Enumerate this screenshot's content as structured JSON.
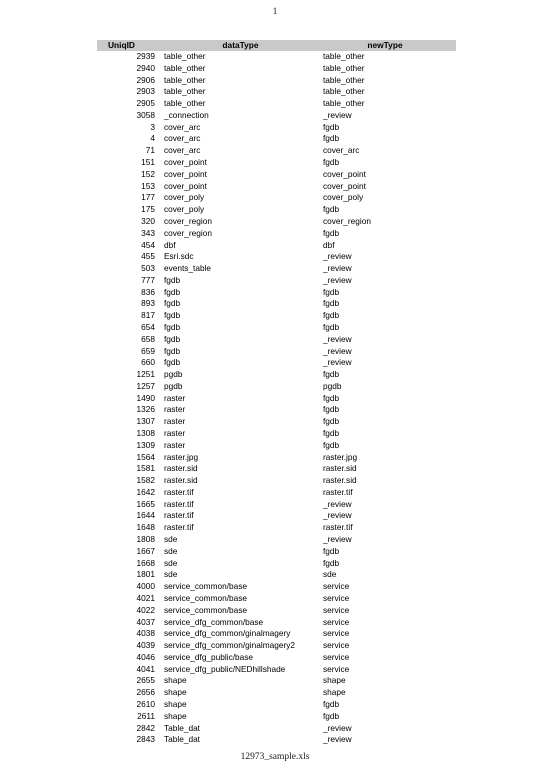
{
  "document": {
    "page_number": "1",
    "filename": "12973_sample.xls"
  },
  "table": {
    "columns": [
      {
        "key": "uniqid",
        "label": "UniqID"
      },
      {
        "key": "datatype",
        "label": "dataType"
      },
      {
        "key": "newtype",
        "label": "newType"
      }
    ],
    "header_background": "#c9c9c9",
    "rows": [
      {
        "uniqid": "2939",
        "datatype": "table_other",
        "newtype": "table_other"
      },
      {
        "uniqid": "2940",
        "datatype": "table_other",
        "newtype": "table_other"
      },
      {
        "uniqid": "2906",
        "datatype": "table_other",
        "newtype": "table_other"
      },
      {
        "uniqid": "2903",
        "datatype": "table_other",
        "newtype": "table_other"
      },
      {
        "uniqid": "2905",
        "datatype": "table_other",
        "newtype": "table_other"
      },
      {
        "uniqid": "3058",
        "datatype": "_connection",
        "newtype": "_review"
      },
      {
        "uniqid": "3",
        "datatype": "cover_arc",
        "newtype": "fgdb"
      },
      {
        "uniqid": "4",
        "datatype": "cover_arc",
        "newtype": "fgdb"
      },
      {
        "uniqid": "71",
        "datatype": "cover_arc",
        "newtype": "cover_arc"
      },
      {
        "uniqid": "151",
        "datatype": "cover_point",
        "newtype": "fgdb"
      },
      {
        "uniqid": "152",
        "datatype": "cover_point",
        "newtype": "cover_point"
      },
      {
        "uniqid": "153",
        "datatype": "cover_point",
        "newtype": "cover_point"
      },
      {
        "uniqid": "177",
        "datatype": "cover_poly",
        "newtype": "cover_poly"
      },
      {
        "uniqid": "175",
        "datatype": "cover_poly",
        "newtype": "fgdb"
      },
      {
        "uniqid": "320",
        "datatype": "cover_region",
        "newtype": "cover_region"
      },
      {
        "uniqid": "343",
        "datatype": "cover_region",
        "newtype": "fgdb"
      },
      {
        "uniqid": "454",
        "datatype": "dbf",
        "newtype": "dbf"
      },
      {
        "uniqid": "455",
        "datatype": "Esri.sdc",
        "newtype": "_review"
      },
      {
        "uniqid": "503",
        "datatype": "events_table",
        "newtype": "_review"
      },
      {
        "uniqid": "777",
        "datatype": "fgdb",
        "newtype": "_review"
      },
      {
        "uniqid": "836",
        "datatype": "fgdb",
        "newtype": "fgdb"
      },
      {
        "uniqid": "893",
        "datatype": "fgdb",
        "newtype": "fgdb"
      },
      {
        "uniqid": "817",
        "datatype": "fgdb",
        "newtype": "fgdb"
      },
      {
        "uniqid": "654",
        "datatype": "fgdb",
        "newtype": "fgdb"
      },
      {
        "uniqid": "658",
        "datatype": "fgdb",
        "newtype": "_review"
      },
      {
        "uniqid": "659",
        "datatype": "fgdb",
        "newtype": "_review"
      },
      {
        "uniqid": "660",
        "datatype": "fgdb",
        "newtype": "_review"
      },
      {
        "uniqid": "1251",
        "datatype": "pgdb",
        "newtype": "fgdb"
      },
      {
        "uniqid": "1257",
        "datatype": "pgdb",
        "newtype": "pgdb"
      },
      {
        "uniqid": "1490",
        "datatype": "raster",
        "newtype": "fgdb"
      },
      {
        "uniqid": "1326",
        "datatype": "raster",
        "newtype": "fgdb"
      },
      {
        "uniqid": "1307",
        "datatype": "raster",
        "newtype": "fgdb"
      },
      {
        "uniqid": "1308",
        "datatype": "raster",
        "newtype": "fgdb"
      },
      {
        "uniqid": "1309",
        "datatype": "raster",
        "newtype": "fgdb"
      },
      {
        "uniqid": "1564",
        "datatype": "raster.jpg",
        "newtype": "raster.jpg"
      },
      {
        "uniqid": "1581",
        "datatype": "raster.sid",
        "newtype": "raster.sid"
      },
      {
        "uniqid": "1582",
        "datatype": "raster.sid",
        "newtype": "raster.sid"
      },
      {
        "uniqid": "1642",
        "datatype": "raster.tif",
        "newtype": "raster.tif"
      },
      {
        "uniqid": "1665",
        "datatype": "raster.tif",
        "newtype": "_review"
      },
      {
        "uniqid": "1644",
        "datatype": "raster.tif",
        "newtype": "_review"
      },
      {
        "uniqid": "1648",
        "datatype": "raster.tif",
        "newtype": "raster.tif"
      },
      {
        "uniqid": "1808",
        "datatype": "sde",
        "newtype": "_review"
      },
      {
        "uniqid": "1667",
        "datatype": "sde",
        "newtype": "fgdb"
      },
      {
        "uniqid": "1668",
        "datatype": "sde",
        "newtype": "fgdb"
      },
      {
        "uniqid": "1801",
        "datatype": "sde",
        "newtype": "sde"
      },
      {
        "uniqid": "4000",
        "datatype": "service_common/base",
        "newtype": "service"
      },
      {
        "uniqid": "4021",
        "datatype": "service_common/base",
        "newtype": "service"
      },
      {
        "uniqid": "4022",
        "datatype": "service_common/base",
        "newtype": "service"
      },
      {
        "uniqid": "4037",
        "datatype": "service_dfg_common/base",
        "newtype": "service"
      },
      {
        "uniqid": "4038",
        "datatype": "service_dfg_common/ginalmagery",
        "newtype": "service"
      },
      {
        "uniqid": "4039",
        "datatype": "service_dfg_common/ginalmagery2",
        "newtype": "service"
      },
      {
        "uniqid": "4046",
        "datatype": "service_dfg_public/base",
        "newtype": "service"
      },
      {
        "uniqid": "4041",
        "datatype": "service_dfg_public/NEDhillshade",
        "newtype": "service"
      },
      {
        "uniqid": "2655",
        "datatype": "shape",
        "newtype": "shape"
      },
      {
        "uniqid": "2656",
        "datatype": "shape",
        "newtype": "shape"
      },
      {
        "uniqid": "2610",
        "datatype": "shape",
        "newtype": "fgdb"
      },
      {
        "uniqid": "2611",
        "datatype": "shape",
        "newtype": "fgdb"
      },
      {
        "uniqid": "2842",
        "datatype": "Table_dat",
        "newtype": "_review"
      },
      {
        "uniqid": "2843",
        "datatype": "Table_dat",
        "newtype": "_review"
      }
    ]
  }
}
